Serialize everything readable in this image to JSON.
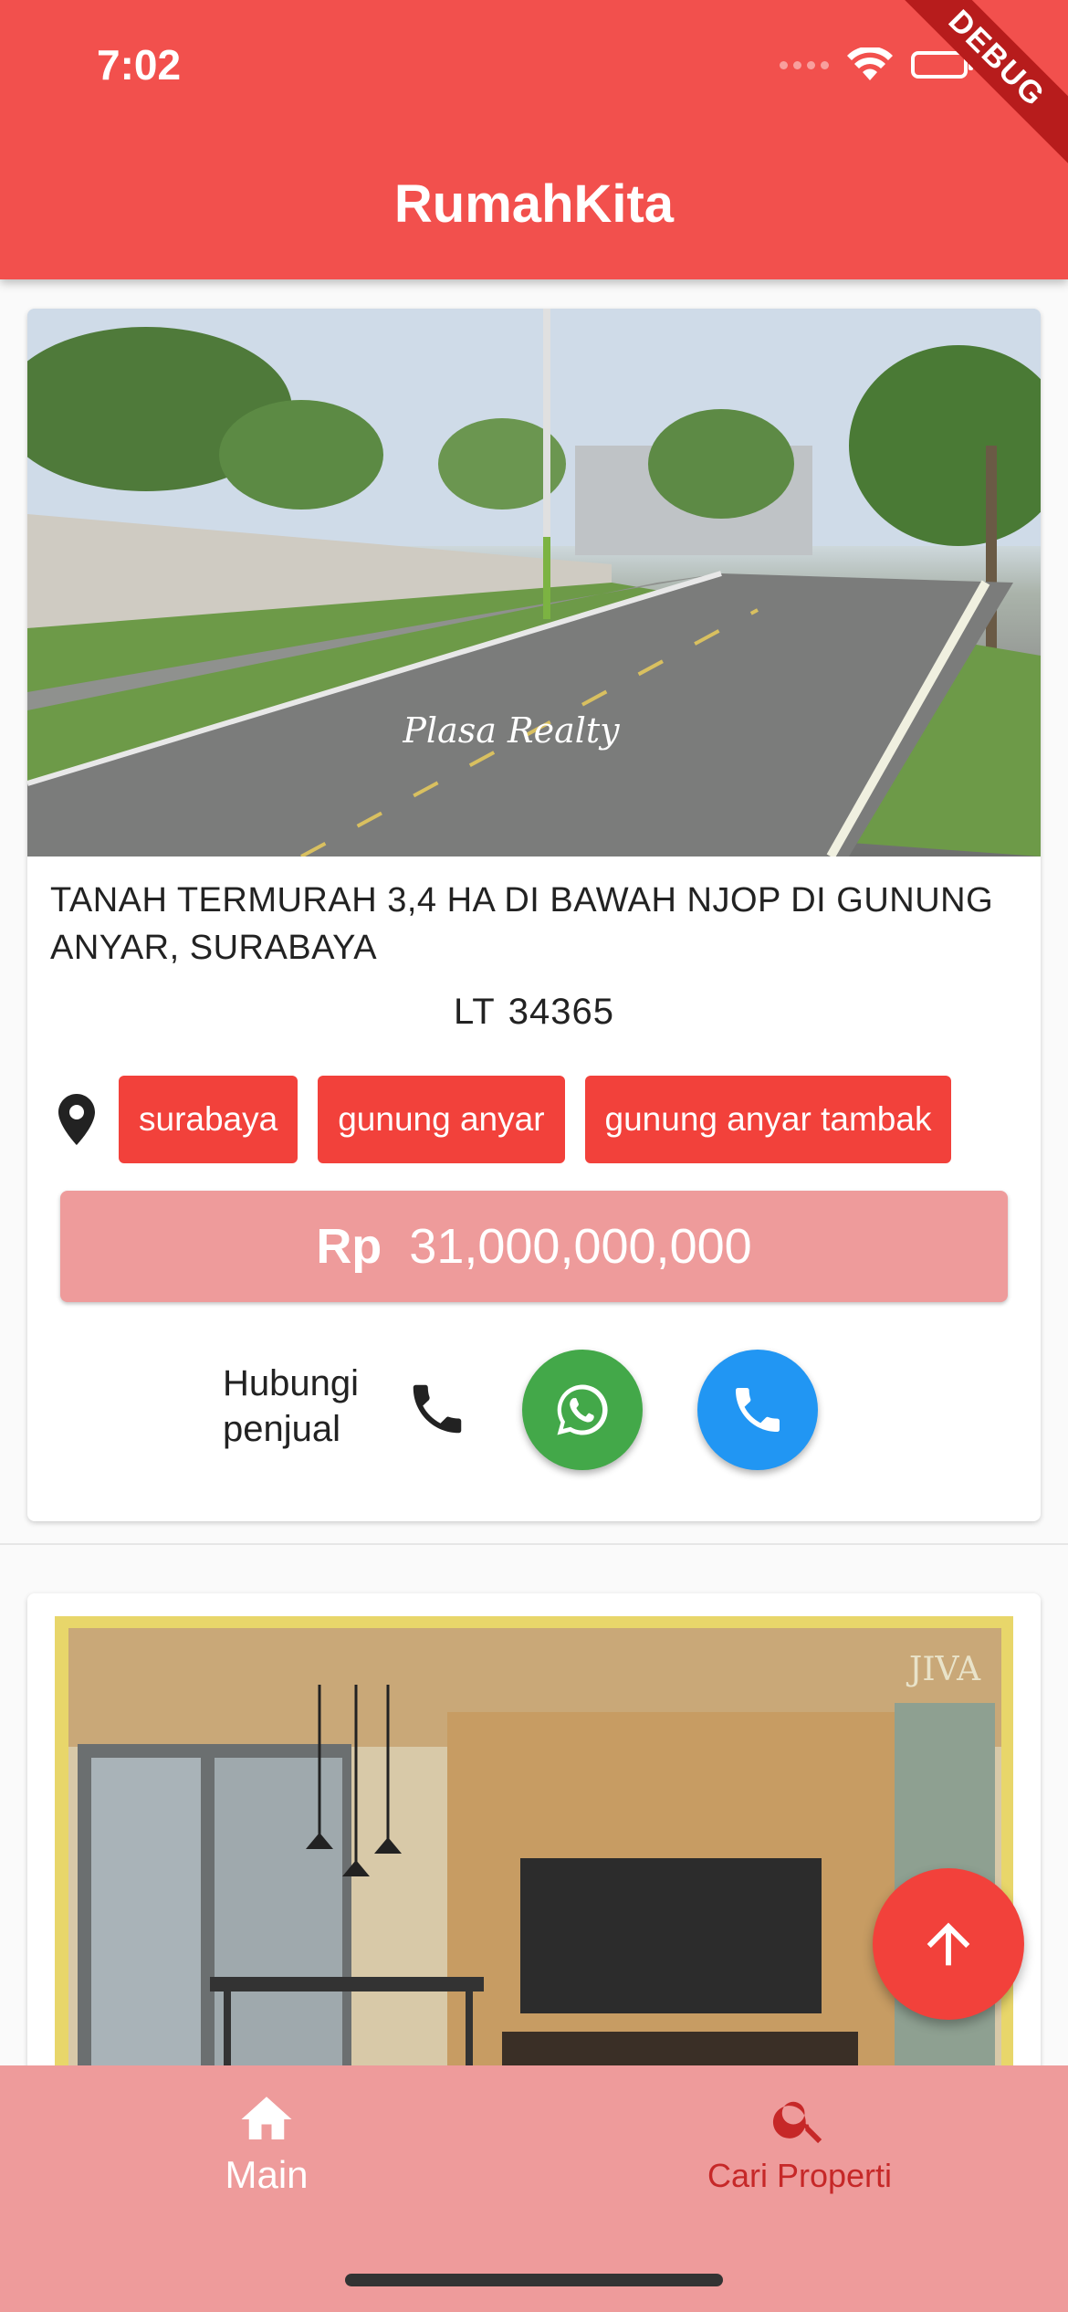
{
  "status_bar": {
    "time": "7:02",
    "debug_banner": "DEBUG"
  },
  "app_bar": {
    "title": "RumahKita"
  },
  "listings": [
    {
      "photo_watermark": "Plasa Realty",
      "title": "TANAH TERMURAH 3,4 HA DI BAWAH NJOP DI GUNUNG ANYAR, SURABAYA",
      "size_label": "LT",
      "size_value": "34365",
      "tags": [
        "surabaya",
        "gunung anyar",
        "gunung anyar tambak"
      ],
      "price_currency": "Rp",
      "price_value": "31,000,000,000",
      "contact_label": "Hubungi penjual"
    },
    {
      "photo_watermark": "JIVA"
    }
  ],
  "bottom_nav": {
    "items": [
      {
        "label": "Main",
        "icon": "home-icon",
        "active": true
      },
      {
        "label": "Cari Properti",
        "icon": "search-icon",
        "active": false
      }
    ]
  },
  "colors": {
    "primary": "#f2504d",
    "tag": "#f2413b",
    "price_bar": "#ee9b9b",
    "whatsapp": "#43a849",
    "call": "#2196f3"
  }
}
